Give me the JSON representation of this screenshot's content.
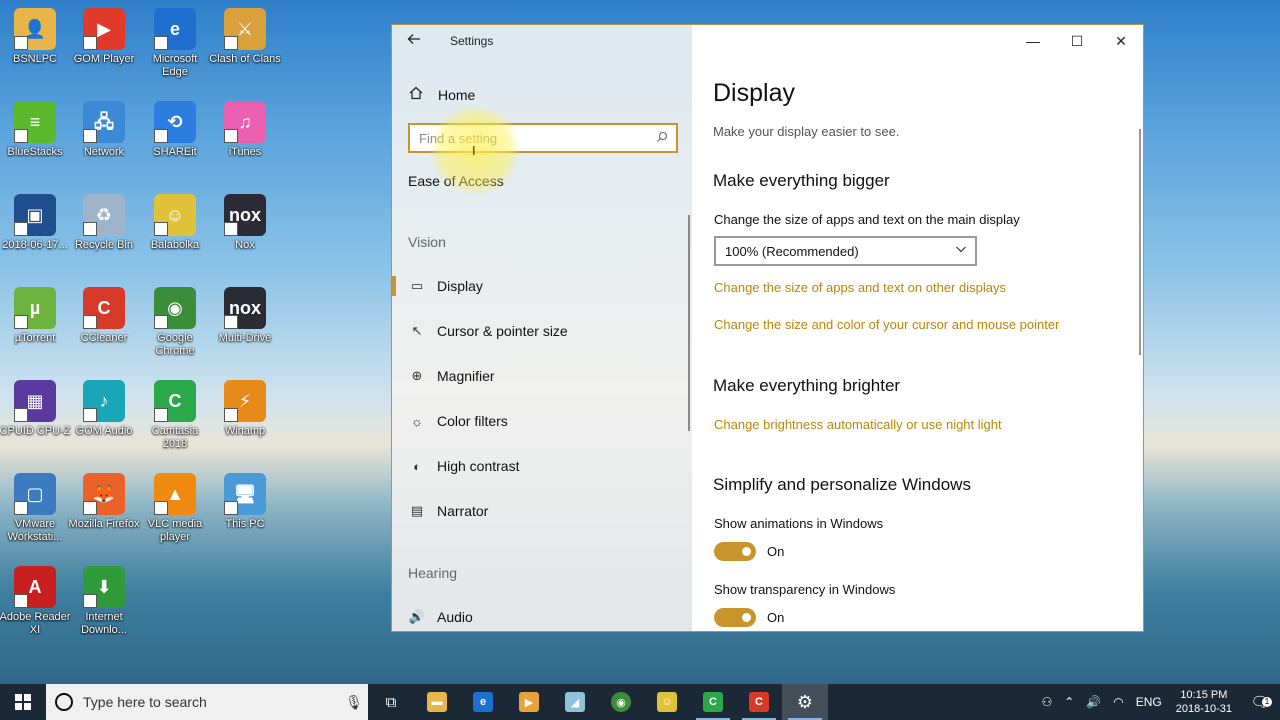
{
  "desktop": {
    "icons": [
      {
        "label": "BSNLPC",
        "bg": "#e8b54a",
        "glyph": "👤"
      },
      {
        "label": "GOM Player",
        "bg": "#e23a2a",
        "glyph": "▶"
      },
      {
        "label": "Microsoft Edge",
        "bg": "#1f6fd1",
        "glyph": "e"
      },
      {
        "label": "Clash of Clans",
        "bg": "#d9a03c",
        "glyph": "⚔"
      },
      {
        "label": "BlueStacks",
        "bg": "#5cb82c",
        "glyph": "≡"
      },
      {
        "label": "Network",
        "bg": "#3a8ad6",
        "glyph": "🖧"
      },
      {
        "label": "SHAREit",
        "bg": "#2d7de0",
        "glyph": "⟲"
      },
      {
        "label": "iTunes",
        "bg": "#ea5fb0",
        "glyph": "♫"
      },
      {
        "label": "2018-06-17...",
        "bg": "#1e4f8c",
        "glyph": "▣"
      },
      {
        "label": "Recycle Bin",
        "bg": "#9fb4c8",
        "glyph": "♻"
      },
      {
        "label": "Balabolka",
        "bg": "#e0c23a",
        "glyph": "☺"
      },
      {
        "label": "Nox",
        "bg": "#2b2b36",
        "glyph": "nox"
      },
      {
        "label": "µTorrent",
        "bg": "#6bb33c",
        "glyph": "µ"
      },
      {
        "label": "CCleaner",
        "bg": "#d83a2a",
        "glyph": "C"
      },
      {
        "label": "Google Chrome",
        "bg": "#3c8d3a",
        "glyph": "◉"
      },
      {
        "label": "Multi-Drive",
        "bg": "#2b2b36",
        "glyph": "nox"
      },
      {
        "label": "CPUID CPU-Z",
        "bg": "#5b3aa0",
        "glyph": "▦"
      },
      {
        "label": "GOM Audio",
        "bg": "#19a7b8",
        "glyph": "♪"
      },
      {
        "label": "Camtasia 2018",
        "bg": "#2aa84a",
        "glyph": "C"
      },
      {
        "label": "Winamp",
        "bg": "#e88a1a",
        "glyph": "⚡"
      },
      {
        "label": "VMware Workstati...",
        "bg": "#3d7bc0",
        "glyph": "▢"
      },
      {
        "label": "Mozilla Firefox",
        "bg": "#e8622a",
        "glyph": "🦊"
      },
      {
        "label": "VLC media player",
        "bg": "#f08a10",
        "glyph": "▲"
      },
      {
        "label": "This PC",
        "bg": "#4a9ad8",
        "glyph": "🖥"
      },
      {
        "label": "Adobe Reader XI",
        "bg": "#c8201e",
        "glyph": "A"
      },
      {
        "label": "Internet Downlo...",
        "bg": "#2f9a3a",
        "glyph": "⬇"
      }
    ]
  },
  "window": {
    "title": "Settings",
    "controls": {
      "minimize": "—",
      "maximize": "☐",
      "close": "✕"
    },
    "nav": {
      "home_label": "Home",
      "search_placeholder": "Find a setting",
      "section_title": "Ease of Access",
      "groups": {
        "vision": "Vision",
        "hearing": "Hearing"
      },
      "items": [
        {
          "label": "Display",
          "icon": "▭"
        },
        {
          "label": "Cursor & pointer size",
          "icon": "↖"
        },
        {
          "label": "Magnifier",
          "icon": "⊕"
        },
        {
          "label": "Color filters",
          "icon": "☼"
        },
        {
          "label": "High contrast",
          "icon": "◐"
        },
        {
          "label": "Narrator",
          "icon": "▤"
        },
        {
          "label": "Audio",
          "icon": "🔊"
        }
      ]
    },
    "content": {
      "title": "Display",
      "subtitle": "Make your display easier to see.",
      "section1": {
        "heading": "Make everything bigger",
        "label": "Change the size of apps and text on the main display",
        "dropdown_value": "100% (Recommended)",
        "link1": "Change the size of apps and text on other displays",
        "link2": "Change the size and color of your cursor and mouse pointer"
      },
      "section2": {
        "heading": "Make everything brighter",
        "link": "Change brightness automatically or use night light"
      },
      "section3": {
        "heading": "Simplify and personalize Windows",
        "animations_label": "Show animations in Windows",
        "animations_state": "On",
        "transparency_label": "Show transparency in Windows",
        "transparency_state": "On"
      }
    }
  },
  "taskbar": {
    "search_placeholder": "Type here to search",
    "tray": {
      "language": "ENG",
      "time": "10:15 PM",
      "date": "2018-10-31",
      "notification_count": "1"
    }
  },
  "colors": {
    "accent": "#c8952c",
    "link": "#b8860b"
  }
}
